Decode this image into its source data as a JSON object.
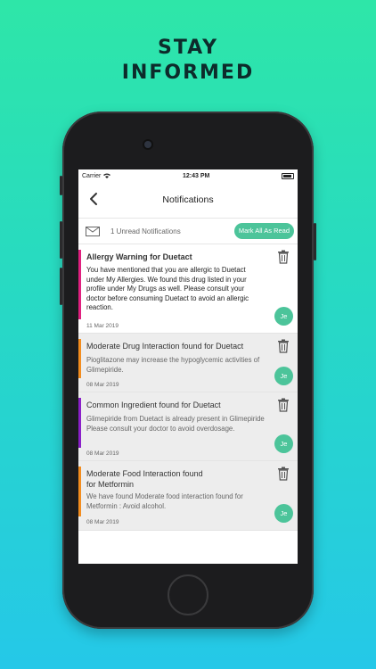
{
  "promo": {
    "line1": "STAY",
    "line2": "INFORMED"
  },
  "status_bar": {
    "carrier": "Carrier",
    "time": "12:43 PM"
  },
  "nav": {
    "title": "Notifications"
  },
  "summary": {
    "text": "1 Unread Notifications",
    "mark_all_label": "Mark All As Read"
  },
  "colors": {
    "accent": "#4cc49a",
    "pink": "#e0207f",
    "orange": "#f28c1e",
    "purple": "#8a1fc9"
  },
  "notifications": [
    {
      "title": "Allergy Warning for Duetact",
      "body": "You have mentioned that you are allergic to Duetact under My Allergies. We found this drug listed in your profile under My Drugs as well. Please consult your doctor before consuming Duetact to avoid an allergic reaction.",
      "date": "11 Mar 2019",
      "avatar": "Je",
      "unread": true
    },
    {
      "title": "Moderate Drug Interaction found for Duetact",
      "body": "Pioglitazone may increase the hypoglycemic activities of Glimepiride.",
      "date": "08 Mar 2019",
      "avatar": "Je",
      "unread": false
    },
    {
      "title": "Common Ingredient found for Duetact",
      "body": "Glimepiride from Duetact is already present in Glimepiride\n Please consult your doctor to avoid overdosage.",
      "date": "08 Mar 2019",
      "avatar": "Je",
      "unread": false
    },
    {
      "title": "Moderate Food Interaction found\nfor Metformin",
      "body": "We have found Moderate food interaction found for Metformin : Avoid alcohol.",
      "date": "08 Mar 2019",
      "avatar": "Je",
      "unread": false
    }
  ]
}
